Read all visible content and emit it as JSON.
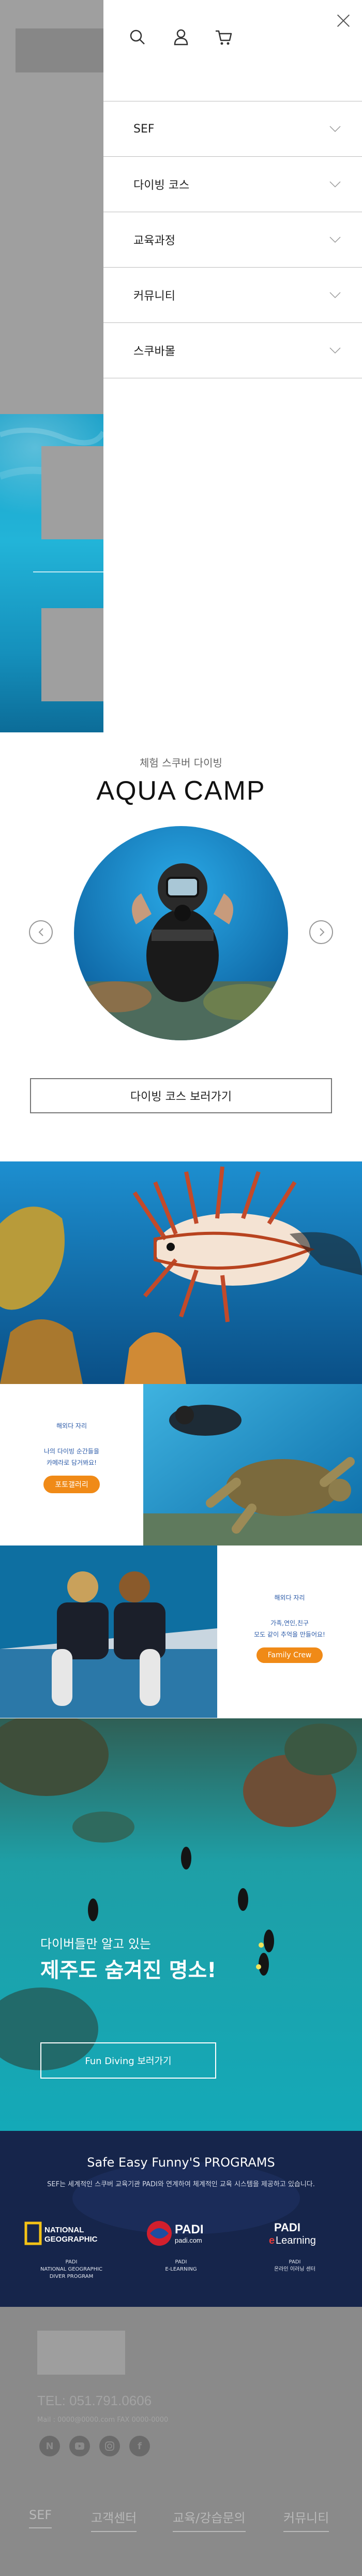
{
  "menu": {
    "items": [
      {
        "label": "SEF"
      },
      {
        "label": "다이빙 코스"
      },
      {
        "label": "교육과정"
      },
      {
        "label": "커뮤니티"
      },
      {
        "label": "스쿠바몰"
      }
    ]
  },
  "camp": {
    "subtitle": "체험 스쿠버 다이빙",
    "title": "AQUA CAMP",
    "button": "다이빙 코스 보러가기"
  },
  "photo_card": {
    "title": "해외다 자리",
    "line1": "나의 다이빙 순간들을",
    "line2": "카메라로 담거봐요!",
    "button": "포토갤러리"
  },
  "crew_card": {
    "title": "해외다 자리",
    "line1": "가족,연인,친구",
    "line2": "모도 같이 추억을 만들어요!",
    "button": "Family Crew"
  },
  "reef": {
    "subtitle": "다이버들만 알고 있는",
    "title": "제주도 숨겨진 명소!",
    "button": "Fun Diving 보러가기"
  },
  "programs": {
    "title": "Safe Easy Funny'S PROGRAMS",
    "subtitle": "SEF는 세계적인 스쿠버 교육기관 PADI와 연계하여 체계적인 교육 시스템을 제공하고 있습니다.",
    "logos": [
      {
        "name": "NATIONAL GEOGRAPHIC",
        "caption1": "PADI",
        "caption2": "NATIONAL GEOGRAPHIC",
        "caption3": "DIVER PROGRAM"
      },
      {
        "name": "PADI padi.com",
        "caption1": "PADI",
        "caption2": "E-LEARNING",
        "caption3": ""
      },
      {
        "name": "PADI eLearning",
        "caption1": "PADI",
        "caption2": "온라인 이러닝 센터",
        "caption3": ""
      }
    ]
  },
  "footer": {
    "tel": "TEL: 051.791.0606",
    "info": "Mail : 0000@0000.com   FAX 0000-0000",
    "nav": [
      "SEF",
      "고객센터",
      "교육/강습문의",
      "커뮤니티"
    ]
  },
  "colors": {
    "accent_orange": "#f08a17",
    "card_blue": "#2b5aa8",
    "programs_bg": "#16254b",
    "overlay_gray": "#9f9f9f"
  },
  "icons": [
    "close-icon",
    "search-icon",
    "user-icon",
    "cart-icon",
    "chevron-down-icon",
    "arrow-left-icon",
    "arrow-right-icon",
    "naver-icon",
    "youtube-icon",
    "instagram-icon",
    "facebook-icon"
  ]
}
